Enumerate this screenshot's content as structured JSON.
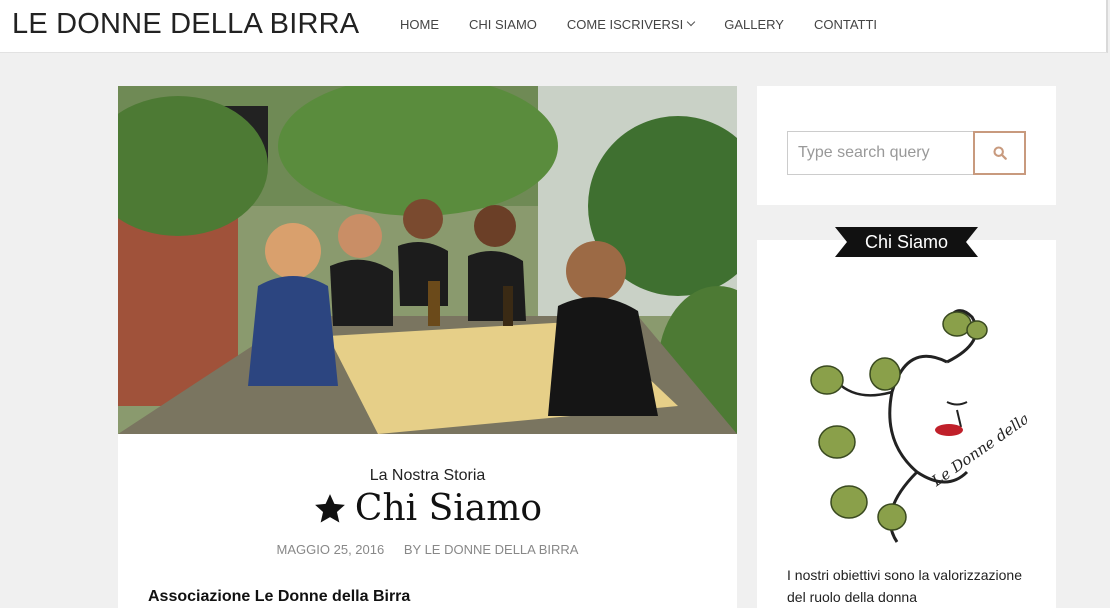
{
  "header": {
    "brand": "LE DONNE DELLA BIRRA",
    "nav": [
      {
        "label": "HOME"
      },
      {
        "label": "CHI SIAMO"
      },
      {
        "label": "COME ISCRIVERSI",
        "dropdown": true
      },
      {
        "label": "GALLERY"
      },
      {
        "label": "CONTATTI"
      }
    ]
  },
  "post": {
    "category": "La Nostra Storia",
    "title": "Chi Siamo",
    "title_icon": "star-icon",
    "date": "MAGGIO 25, 2016",
    "author": "BY LE DONNE DELLA BIRRA",
    "excerpt_heading": "Associazione Le Donne della Birra"
  },
  "sidebar": {
    "search": {
      "placeholder": "Type search query",
      "button_icon": "search-icon"
    },
    "about": {
      "title": "Chi Siamo",
      "logo_text": "Le Donne della Birra",
      "text": "I nostri obiettivi sono la valorizzazione del ruolo della donna"
    }
  },
  "colors": {
    "accent": "#c89a7e",
    "ribbon": "#111111",
    "background": "#f0f0f0"
  }
}
